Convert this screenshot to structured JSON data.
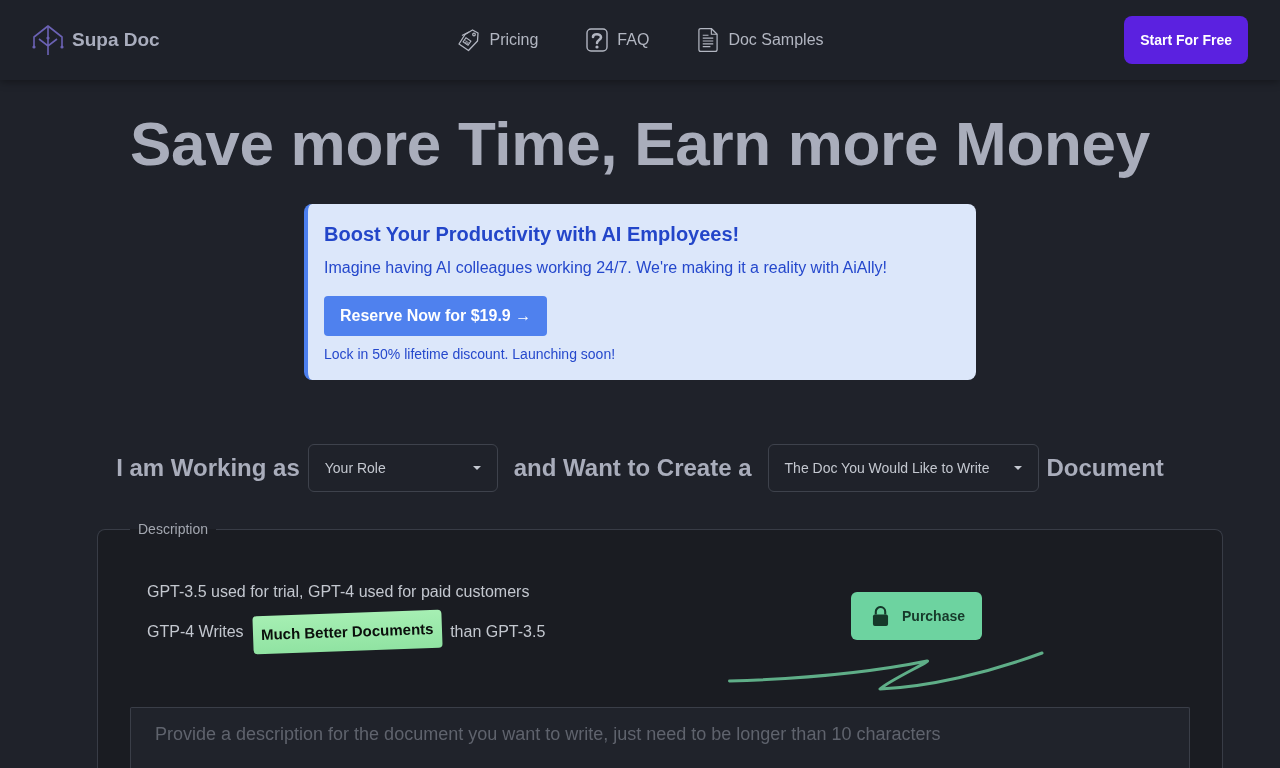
{
  "header": {
    "logo": {
      "text": "Supa Doc"
    },
    "nav": [
      {
        "kind": "tag",
        "label": "Pricing"
      },
      {
        "kind": "question",
        "label": "FAQ"
      },
      {
        "kind": "document",
        "label": "Doc Samples"
      }
    ],
    "cta_button": "Start For Free"
  },
  "hero": {
    "title": "Save more Time, Earn more Money"
  },
  "banner": {
    "title": "Boost Your Productivity with AI Employees!",
    "text": "Imagine having AI colleagues working 24/7. We're making it a reality with AiAlly!",
    "button": "Reserve Now for $19.9 →",
    "note": "Lock in 50% lifetime discount. Launching soon!"
  },
  "role_sentence": [
    {
      "kind": "text",
      "text": "I am Working as"
    },
    {
      "kind": "select",
      "value": "Your Role"
    },
    {
      "kind": "text",
      "text": "and Want to Create a"
    },
    {
      "kind": "select",
      "value": "The Doc You Would Like to Write"
    },
    {
      "kind": "text",
      "text": "Document"
    }
  ],
  "description": {
    "legend": "Description",
    "lines": [
      {
        "parts": [
          {
            "kind": "text",
            "text": "GPT-3.5 used for trial, GPT-4 used for paid customers"
          }
        ]
      },
      {
        "parts": [
          {
            "kind": "text",
            "text": "GTP-4 Writes"
          },
          {
            "kind": "highlight",
            "text": "Much Better Documents"
          },
          {
            "kind": "text",
            "text": "than GPT-3.5"
          }
        ]
      }
    ],
    "purchase_button": "Purchase",
    "textarea": {
      "placeholder": "Provide a description for the document you want to write, just need to be longer than 10 characters"
    }
  }
}
